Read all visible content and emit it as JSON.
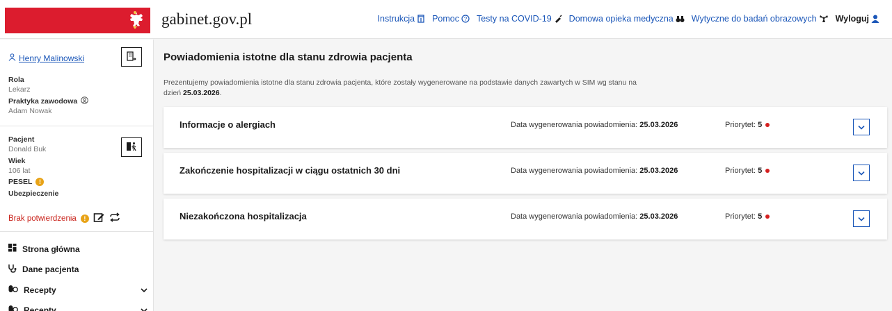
{
  "header": {
    "site_title": "gabinet.gov.pl",
    "nav": [
      {
        "label": "Instrukcja",
        "icon": "manual-icon"
      },
      {
        "label": "Pomoc",
        "icon": "help-icon"
      },
      {
        "label": "Testy na COVID-19",
        "icon": "syringe-icon"
      },
      {
        "label": "Domowa opieka medyczna",
        "icon": "binoculars-icon"
      },
      {
        "label": "Wytyczne do badań obrazowych",
        "icon": "radiation-icon"
      },
      {
        "label": "Wyloguj",
        "icon": "user-icon"
      }
    ]
  },
  "sidebar": {
    "user_name": "Henry Malinowski",
    "role_label": "Rola",
    "role_value": "Lekarz",
    "practice_label": "Praktyka zawodowa",
    "practice_value": "Adam Nowak",
    "patient_label": "Pacjent",
    "patient_value": "Donald Buk",
    "age_label": "Wiek",
    "age_value": "106 lat",
    "pesel_label": "PESEL",
    "insurance_label": "Ubezpieczenie",
    "insurance_status": "Brak potwierdzenia",
    "nav_items": [
      {
        "label": "Strona główna",
        "icon": "dashboard-icon"
      },
      {
        "label": "Dane pacjenta",
        "icon": "stethoscope-icon"
      },
      {
        "label": "Recepty",
        "icon": "pills-icon"
      },
      {
        "label": "Recepty",
        "icon": "pills-icon"
      }
    ]
  },
  "main": {
    "title": "Powiadomienia istotne dla stanu zdrowia pacjenta",
    "description": "Prezentujemy powiadomienia istotne dla stanu zdrowia pacjenta, które zostały wygenerowane na podstawie danych zawartych w SIM wg stanu na dzień",
    "description_date": "25.03.2026",
    "date_label": "Data wygenerowania powiadomienia:",
    "priority_label": "Priorytet:",
    "notifications": [
      {
        "title": "Informacje o alergiach",
        "date": "25.03.2026",
        "priority": "5",
        "priority_color": "#d42020"
      },
      {
        "title": "Zakończenie hospitalizacji w ciągu ostatnich 30 dni",
        "date": "25.03.2026",
        "priority": "5",
        "priority_color": "#d42020"
      },
      {
        "title": "Niezakończona hospitalizacja",
        "date": "25.03.2026",
        "priority": "5",
        "priority_color": "#d42020"
      }
    ]
  },
  "colors": {
    "brand_red": "#dc1c2e",
    "link_blue": "#1a56b8",
    "warning_red": "#c9231b",
    "info_amber": "#e8a317"
  }
}
